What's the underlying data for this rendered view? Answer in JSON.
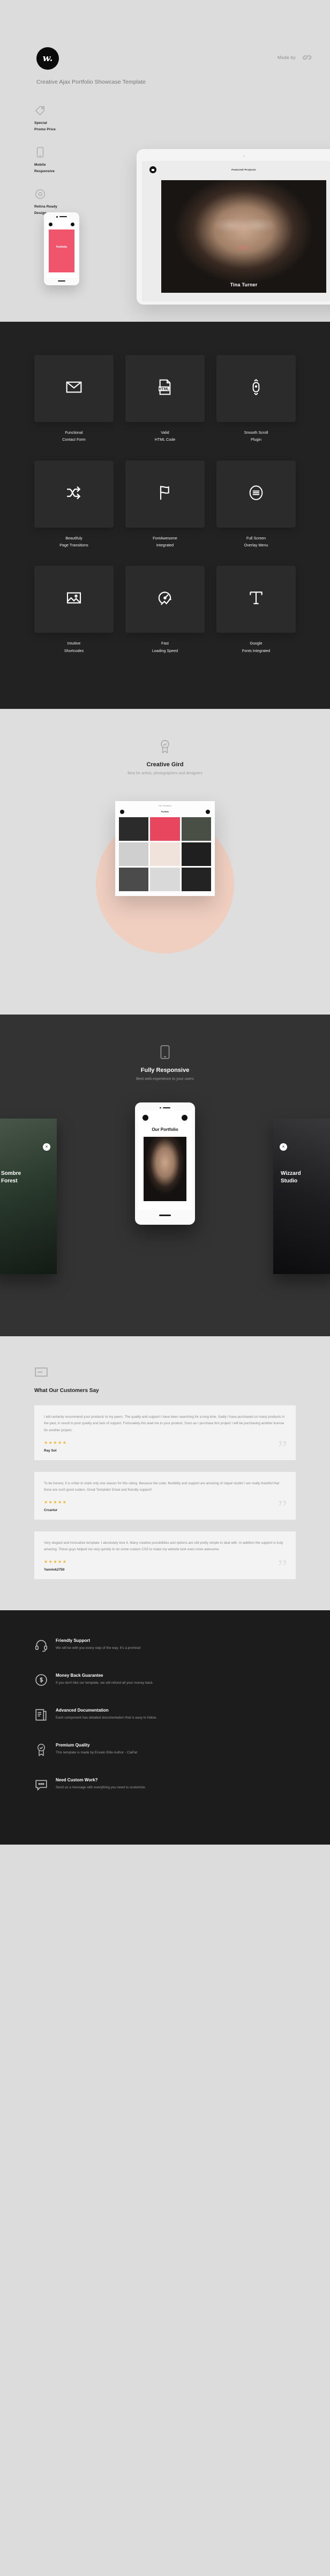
{
  "hero": {
    "logo_text": "w.",
    "made_by_label": "Made by",
    "made_by_mark": "clapat-logo-icon",
    "title": "Creative Ajax Portfolio Showcase Template",
    "features": [
      {
        "icon": "price-tag-icon",
        "label": "Special\nPromo Price"
      },
      {
        "icon": "mobile-phone-icon",
        "label": "Mobile\nResponsive"
      },
      {
        "icon": "retina-eye-icon",
        "label": "Retina Ready\nDesign"
      }
    ],
    "tablet": {
      "section_label": "Featured Projects",
      "project_name": "Tina Turner"
    },
    "phone": {
      "label": "Portfolio"
    }
  },
  "features_grid": {
    "cards": [
      {
        "icon": "envelope-icon",
        "line1": "Functional",
        "line2": "Contact Form"
      },
      {
        "icon": "html-file-icon",
        "line1": "Valid",
        "line2": "HTML Code"
      },
      {
        "icon": "mouse-scroll-icon",
        "line1": "Smooth Scroll",
        "line2": "Plugin"
      },
      {
        "icon": "shuffle-icon",
        "line1": "Beautifuly",
        "line2": "Page Transitions"
      },
      {
        "icon": "flag-icon",
        "line1": "FontAwesome",
        "line2": "Integrated"
      },
      {
        "icon": "menu-circle-icon",
        "line1": "Full Screen",
        "line2": "Overlay Menu"
      },
      {
        "icon": "image-icon",
        "line1": "Intuitive",
        "line2": "Shortcodes"
      },
      {
        "icon": "speedometer-icon",
        "line1": "Fast",
        "line2": "Loading Speed"
      },
      {
        "icon": "typography-t-icon",
        "line1": "Google",
        "line2": "Fonts Integrated"
      }
    ]
  },
  "creative_grid": {
    "icon": "award-badge-icon",
    "title": "Creative Gird",
    "subtitle": "Best for artists, photographers and designers",
    "browser": {
      "header": "Our Portfolio",
      "nav_label": "Portfolio"
    },
    "tiles": [
      {
        "caption": "",
        "color": "#2b2b2b"
      },
      {
        "caption": "",
        "color": "#e8455f"
      },
      {
        "caption": "",
        "color": "#4a4f46"
      },
      {
        "caption": "",
        "color": "#cfcfcf"
      },
      {
        "caption": "",
        "color": "#efe3dc"
      },
      {
        "caption": "",
        "color": "#1f1f1f"
      },
      {
        "caption": "",
        "color": "#4b4b4b"
      },
      {
        "caption": "",
        "color": "#d9d9d9"
      },
      {
        "caption": "",
        "color": "#232323"
      }
    ]
  },
  "responsive": {
    "icon": "mobile-phone-icon",
    "title": "Fully Responsive",
    "subtitle": "Best web experience to your users",
    "left_project": "Sombre\nForest",
    "right_project": "Wizzard\nStudio",
    "phone": {
      "title": "Our Portfolio"
    }
  },
  "testimonials": {
    "icon": "chat-bubble-icon",
    "title": "What Our Customers Say",
    "items": [
      {
        "text": "I will certainly recommend your products to my peers. The quality and support I have been searching for a long time. Sadly I have purchased so many products in the past, in result to poor quality and lack of support. Fortunately this lead me to your product. Soon as I purchase this project I will be purchasing another license for another project.",
        "stars": "★★★★★",
        "rating": 5,
        "author": "Ray Sol"
      },
      {
        "text": "To be honest, it is unfair to mark only one reason for this rating. Because the code, flexibility and support are amazing of clapat studio! I am really thankful that there are such good coders. Great Tomplate! Great and friendly support!",
        "stars": "★★★★★",
        "rating": 5,
        "author": "Crcartur"
      },
      {
        "text": "Very elegant and innovative template. I absolutely love it. Many creative possibilities and options are still pretty simple to deal with. In addition the support is truly amazing. These guys helped me very quickly to do some custom CSS to make my website look even more awesome.",
        "stars": "★★★★★",
        "rating": 5,
        "author": "Yannivk2750"
      }
    ]
  },
  "footer": {
    "items": [
      {
        "icon": "headset-support-icon",
        "title": "Friendly Support",
        "desc": "We will be with you every step of the way. It's a promise!"
      },
      {
        "icon": "money-back-icon",
        "title": "Money Back Guarantee",
        "desc": "If you don't like our template, we will refund all your money back."
      },
      {
        "icon": "documentation-icon",
        "title": "Advanced Documentation",
        "desc": "Each component has detailed documentation that is easy to follow."
      },
      {
        "icon": "award-badge-icon",
        "title": "Premium Quality",
        "desc": "This template is made by Envato Elite Author - ClaPat"
      },
      {
        "icon": "custom-work-icon",
        "title": "Need Custom Work?",
        "desc": "Send us a message with everything you need to customize."
      }
    ]
  }
}
